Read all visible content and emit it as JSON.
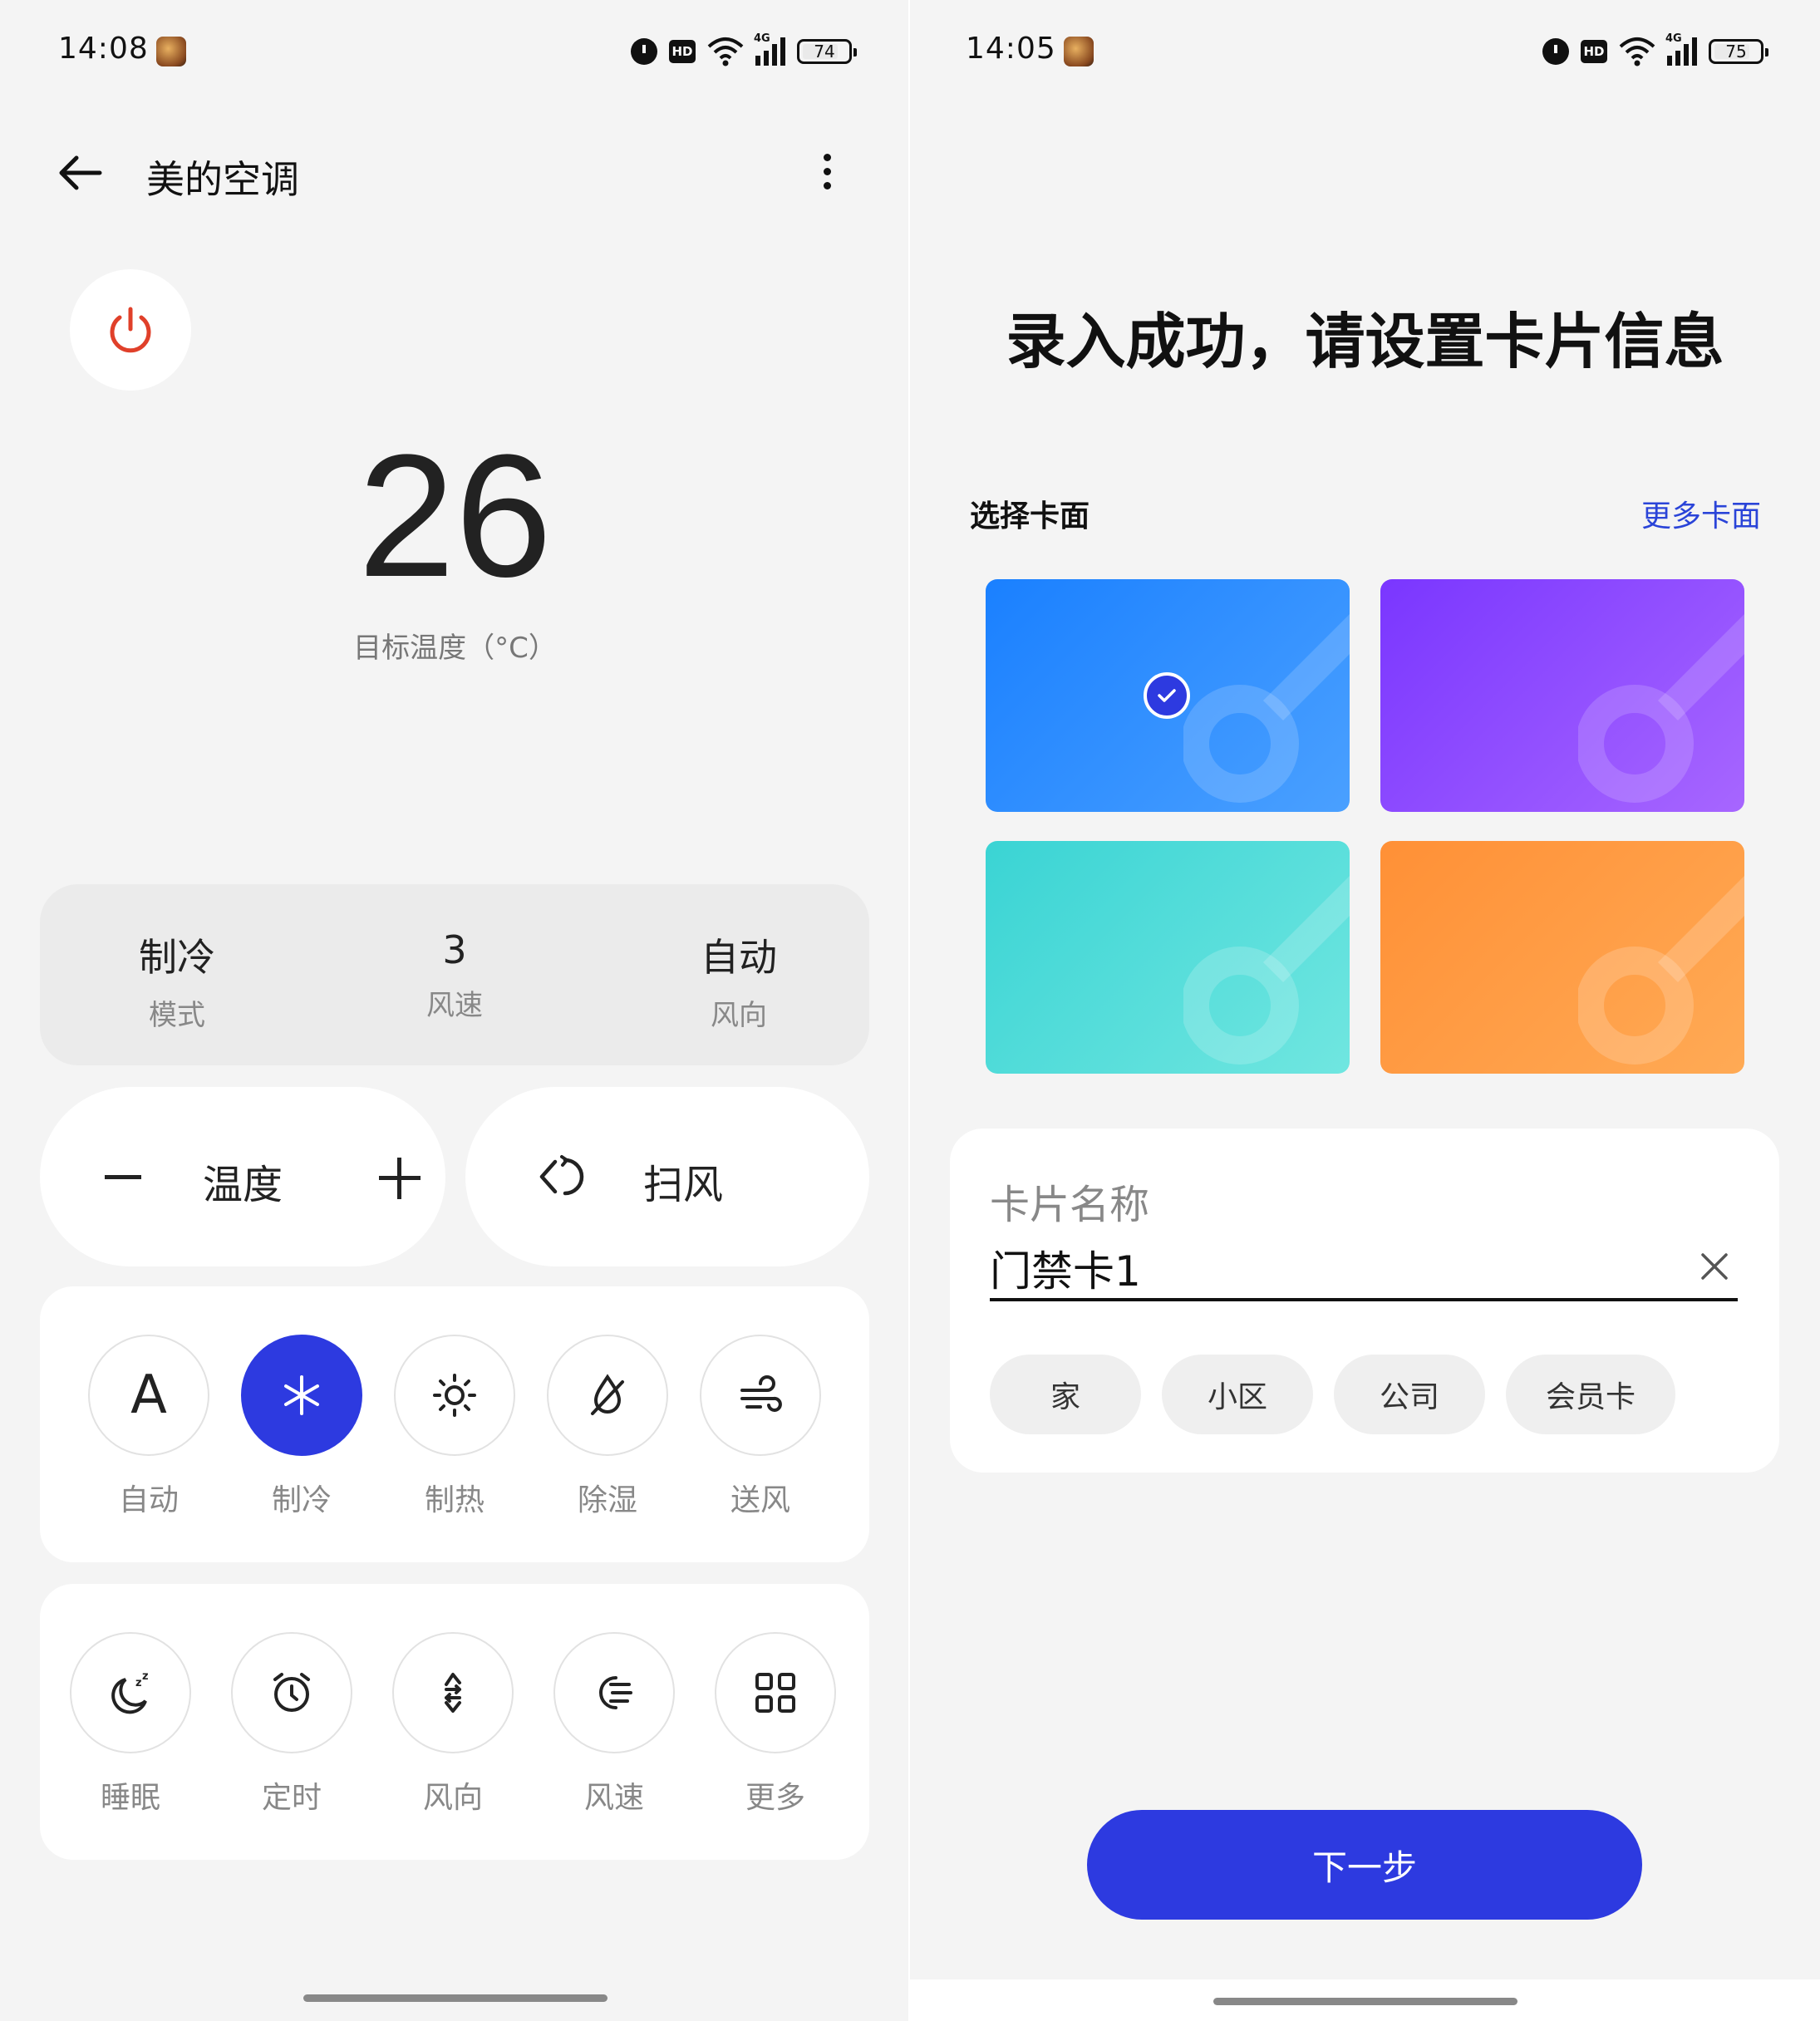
{
  "left": {
    "status_bar": {
      "time": "14:08",
      "battery": "74"
    },
    "header": {
      "title": "美的空调"
    },
    "power_color": "#e0402a",
    "temperature": {
      "value": "26",
      "caption": "目标温度（°C）"
    },
    "status": [
      {
        "value": "制冷",
        "label": "模式"
      },
      {
        "value": "3",
        "label": "风速"
      },
      {
        "value": "自动",
        "label": "风向"
      }
    ],
    "temp_control": {
      "label": "温度"
    },
    "swing": {
      "label": "扫风"
    },
    "modes": [
      {
        "icon": "auto-icon",
        "label": "自动",
        "active": false
      },
      {
        "icon": "snowflake-icon",
        "label": "制冷",
        "active": true
      },
      {
        "icon": "sun-icon",
        "label": "制热",
        "active": false
      },
      {
        "icon": "dehumidify-icon",
        "label": "除湿",
        "active": false
      },
      {
        "icon": "wind-icon",
        "label": "送风",
        "active": false
      }
    ],
    "functions": [
      {
        "icon": "sleep-moon-icon",
        "label": "睡眠"
      },
      {
        "icon": "alarm-clock-icon",
        "label": "定时"
      },
      {
        "icon": "wind-direction-icon",
        "label": "风向"
      },
      {
        "icon": "fan-speed-icon",
        "label": "风速"
      },
      {
        "icon": "grid-icon",
        "label": "更多"
      }
    ],
    "accent": "#2d3ae0"
  },
  "right": {
    "status_bar": {
      "time": "14:05",
      "battery": "75"
    },
    "title": "录入成功，请设置卡片信息",
    "section_label": "选择卡面",
    "more_faces": "更多卡面",
    "card_faces": [
      {
        "colors": [
          "#1a80ff",
          "#4aa0ff"
        ],
        "selected": true
      },
      {
        "colors": [
          "#7a36ff",
          "#a766ff"
        ],
        "selected": false
      },
      {
        "colors": [
          "#3ad4d4",
          "#70e6e0"
        ],
        "selected": false
      },
      {
        "colors": [
          "#ff9036",
          "#ffaa55"
        ],
        "selected": false
      }
    ],
    "name_field": {
      "label": "卡片名称",
      "value": "门禁卡1"
    },
    "chips": [
      "家",
      "小区",
      "公司",
      "会员卡"
    ],
    "next_button": "下一步"
  }
}
